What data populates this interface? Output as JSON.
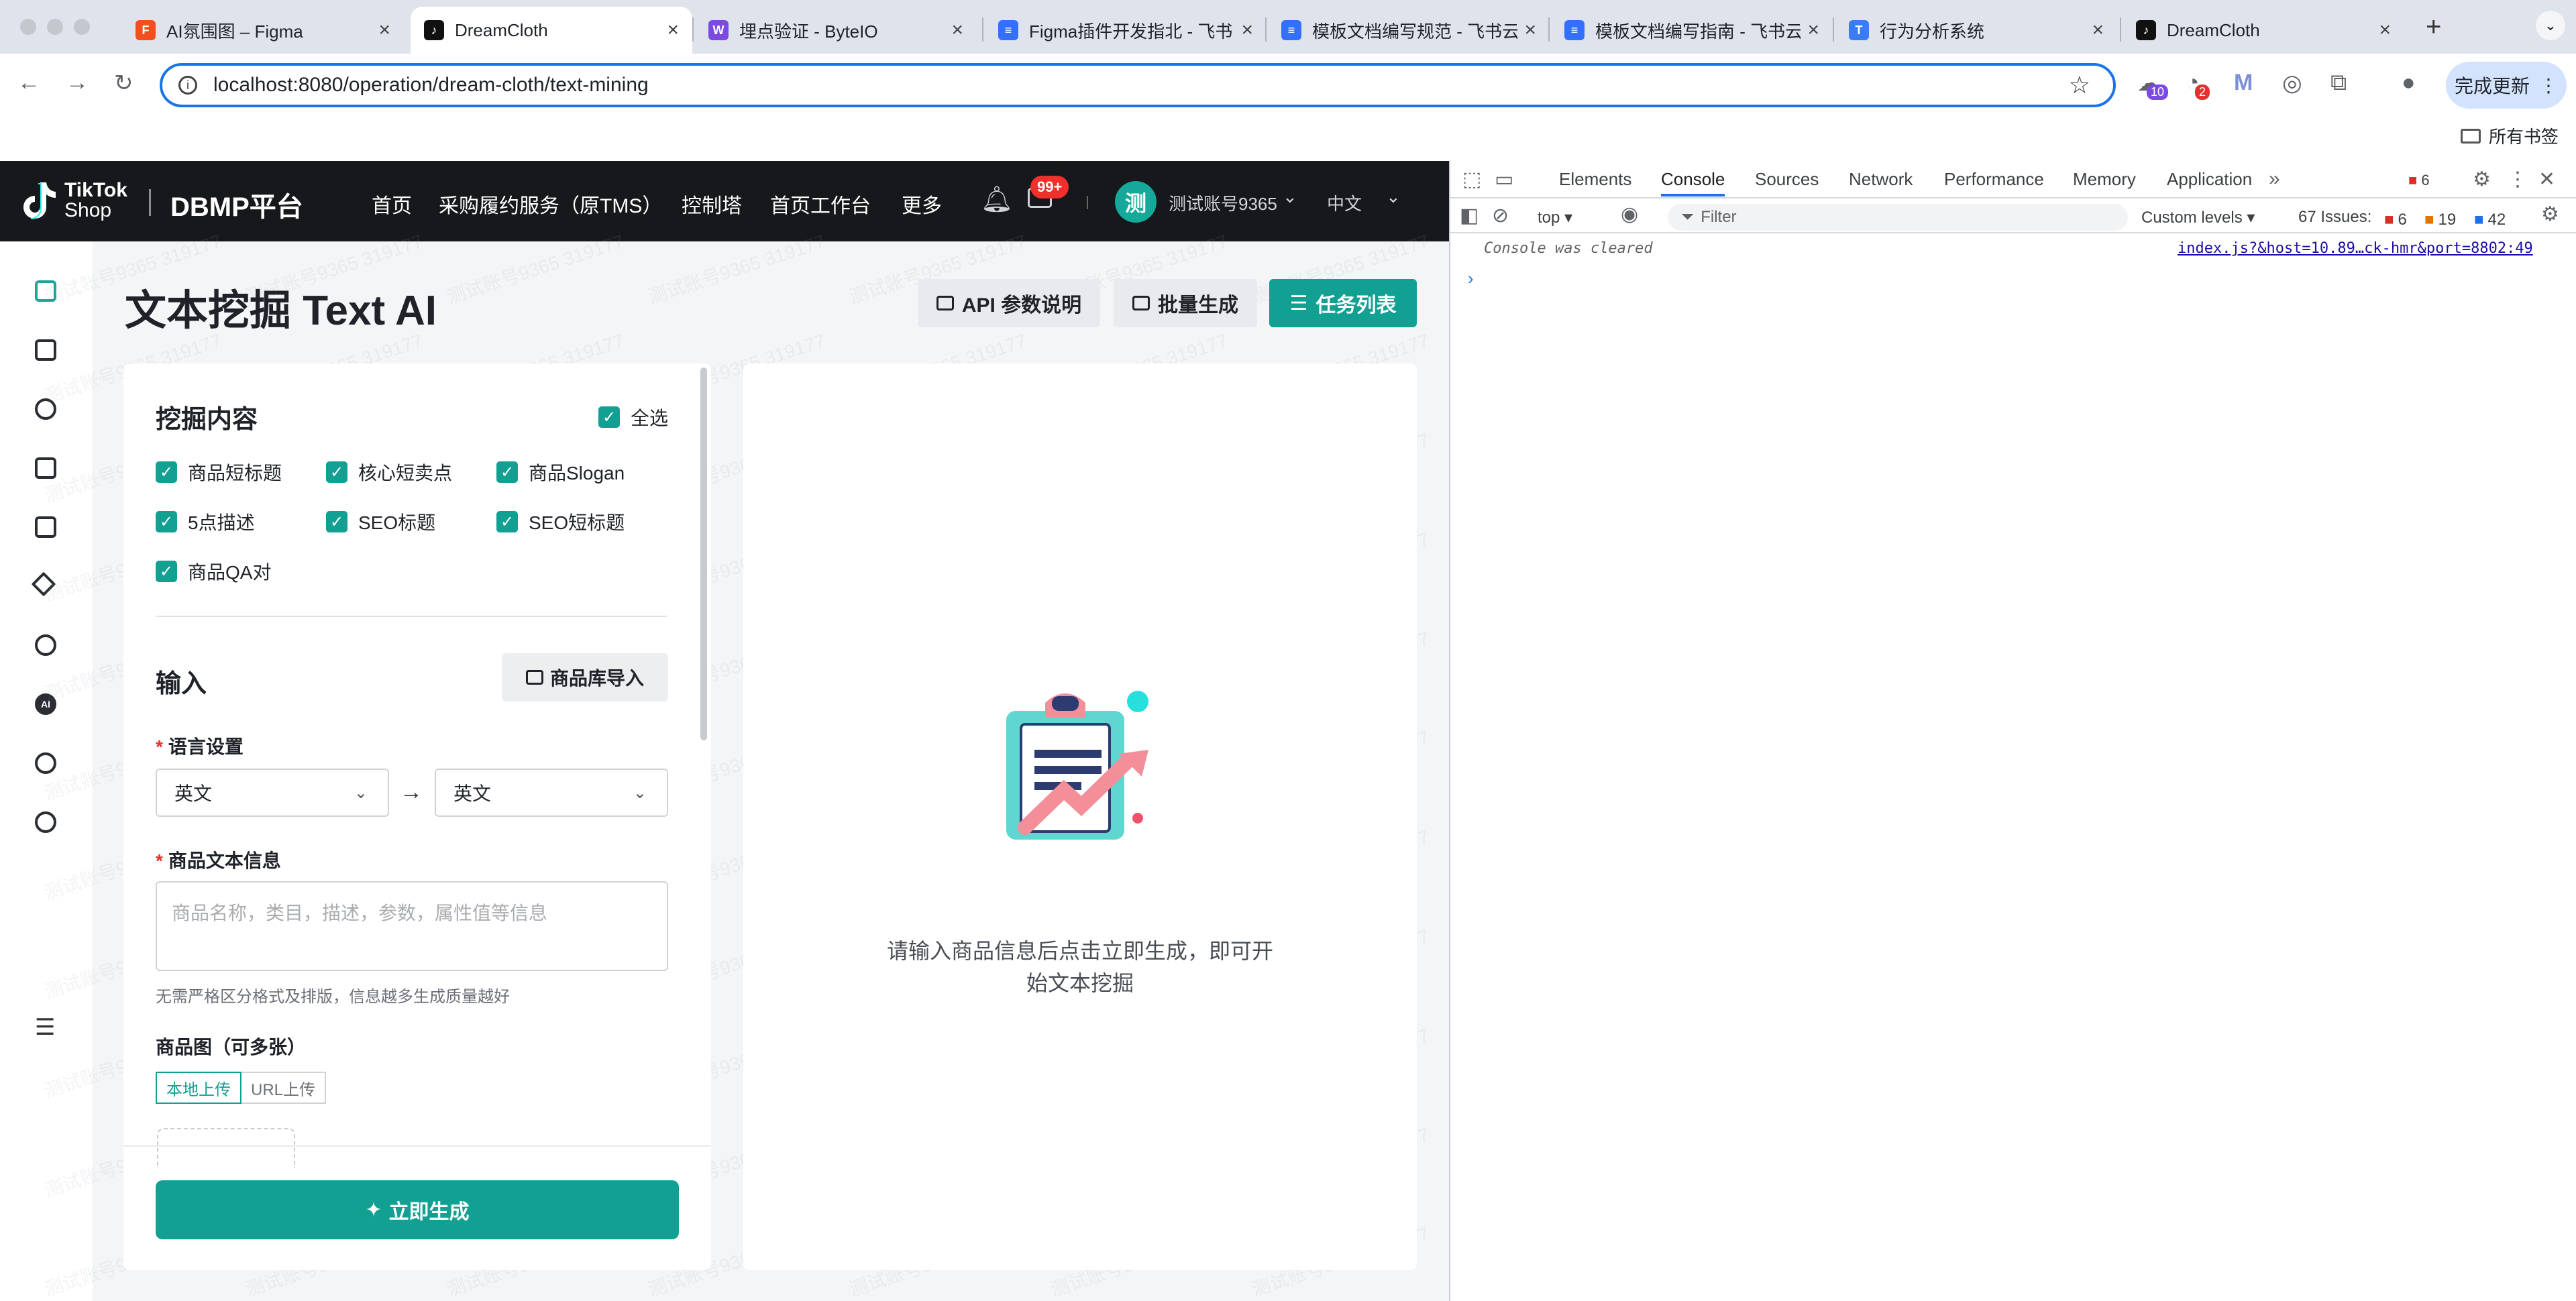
{
  "browser": {
    "tabs": [
      {
        "label": "AI氛围图 – Figma",
        "icon": "figma-icon",
        "color": "#f24e1e",
        "glyph": "F"
      },
      {
        "label": "DreamCloth",
        "icon": "tiktok-icon",
        "color": "#111111",
        "glyph": "♪"
      },
      {
        "label": "埋点验证 - ByteIO",
        "icon": "byteio-icon",
        "color": "#7b4ae2",
        "glyph": "W"
      },
      {
        "label": "Figma插件开发指北 - 飞书",
        "icon": "lark-doc-icon",
        "color": "#3370ff",
        "glyph": "≡"
      },
      {
        "label": "模板文档编写规范 - 飞书云",
        "icon": "lark-doc-icon",
        "color": "#3370ff",
        "glyph": "≡"
      },
      {
        "label": "模板文档编写指南 - 飞书云",
        "icon": "lark-doc-icon",
        "color": "#3370ff",
        "glyph": "≡"
      },
      {
        "label": "行为分析系统",
        "icon": "tea-icon",
        "color": "#3a7cf6",
        "glyph": "T"
      },
      {
        "label": "DreamCloth",
        "icon": "tiktok-icon",
        "color": "#111111",
        "glyph": "♪"
      }
    ],
    "url": "localhost:8080/operation/dream-cloth/text-mining",
    "update_label": "完成更新",
    "bookmarks_label": "所有书签",
    "ext_badges": [
      "10",
      "2"
    ]
  },
  "header": {
    "logo_line1": "TikTok",
    "logo_line2": "Shop",
    "platform": "DBMP平台",
    "nav": [
      "首页",
      "采购履约服务（原TMS）",
      "控制塔",
      "首页工作台",
      "更多"
    ],
    "msg_badge": "99+",
    "avatar": "测",
    "username": "测试账号9365",
    "lang": "中文"
  },
  "page": {
    "title": "文本挖掘 Text AI",
    "api_btn": "API 参数说明",
    "batch_btn": "批量生成",
    "task_btn": "任务列表"
  },
  "left": {
    "mining_title": "挖掘内容",
    "select_all": "全选",
    "options": [
      "商品短标题",
      "核心短卖点",
      "商品Slogan",
      "5点描述",
      "SEO标题",
      "SEO短标题",
      "商品QA对"
    ],
    "input_title": "输入",
    "import_btn": "商品库导入",
    "lang_label": "语言设置",
    "lang_from": "英文",
    "lang_to": "英文",
    "text_label": "商品文本信息",
    "text_placeholder": "商品名称，类目，描述，参数，属性值等信息",
    "hint": "无需严格区分格式及排版，信息越多生成质量越好",
    "image_label": "商品图（可多张）",
    "upload_local": "本地上传",
    "upload_url": "URL上传",
    "generate_btn": "立即生成"
  },
  "right": {
    "empty_text": "请输入商品信息后点击立即生成，即可开始文本挖掘"
  },
  "watermark": "测试账号9365 319177",
  "devtools": {
    "tabs": [
      "Elements",
      "Console",
      "Sources",
      "Network",
      "Performance",
      "Memory",
      "Application"
    ],
    "error_count": "6",
    "context": "top",
    "filter": "Filter",
    "levels": "Custom levels",
    "issues_label": "67 Issues:",
    "issue_errors": "6",
    "issue_warnings": "19",
    "issue_info": "42",
    "console_msg": "Console was cleared",
    "console_link": "index.js?&host=10.89…ck-hmr&port=8802:49"
  },
  "colors": {
    "accent": "#12a093",
    "header_bg": "#16181c",
    "badge": "#f0302d",
    "link": "#1a73e8"
  }
}
